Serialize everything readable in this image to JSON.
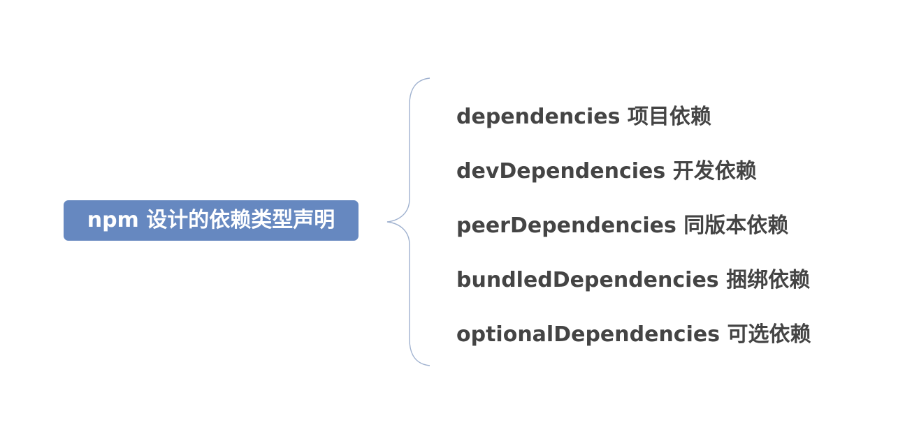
{
  "mindmap": {
    "root": {
      "label": "npm 设计的依赖类型声明",
      "color": "#6688c0"
    },
    "branch_color": "#9fb1cf",
    "children": [
      {
        "label": "dependencies 项目依赖"
      },
      {
        "label": "devDependencies 开发依赖"
      },
      {
        "label": "peerDependencies 同版本依赖"
      },
      {
        "label": "bundledDependencies 捆绑依赖"
      },
      {
        "label": "optionalDependencies 可选依赖"
      }
    ]
  }
}
